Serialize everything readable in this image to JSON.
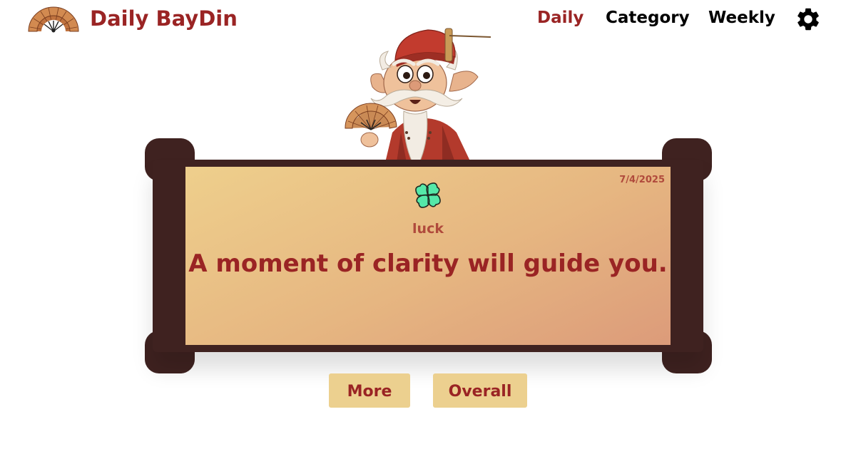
{
  "header": {
    "brand": "Daily BayDin",
    "logo_icon": "folding-fan-icon",
    "nav": {
      "daily": "Daily",
      "category": "Category",
      "weekly": "Weekly",
      "active": "Daily"
    },
    "settings_icon": "gear-icon"
  },
  "fortune": {
    "date": "7/4/2025",
    "category_icon": "four-leaf-clover-icon",
    "category": "luck",
    "message": "A moment of clarity will guide you."
  },
  "actions": {
    "more_label": "More",
    "overall_label": "Overall"
  },
  "colors": {
    "brand_red": "#9a2424",
    "scroll_brown": "#3f2220",
    "paper_light": "#eecf8c",
    "paper_dark": "#dc9b7a",
    "button_bg": "#ecd08f",
    "clover_green": "#55e8a8"
  }
}
